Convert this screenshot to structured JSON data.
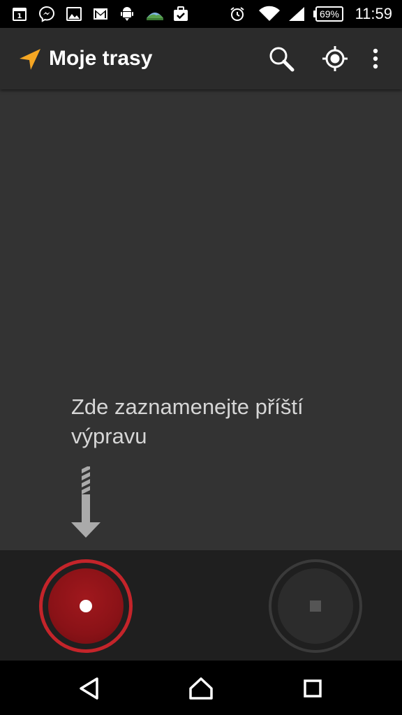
{
  "status_bar": {
    "calendar_day": "1",
    "battery": "69%",
    "time": "11:59"
  },
  "app_bar": {
    "title": "Moje trasy"
  },
  "content": {
    "hint": "Zde zaznamenejte příští výpravu"
  },
  "colors": {
    "accent": "#f5a623",
    "record": "#c4242a",
    "background": "#333333"
  }
}
